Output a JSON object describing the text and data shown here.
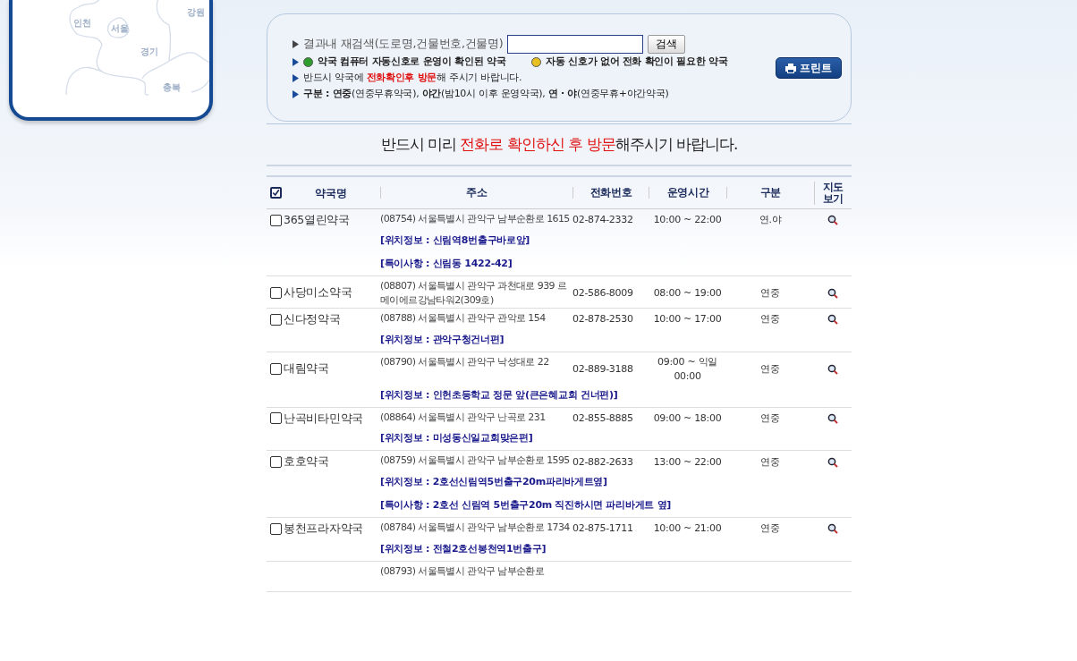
{
  "map": {
    "regions": [
      {
        "label": "강원"
      },
      {
        "label": "인천"
      },
      {
        "label": "서울"
      },
      {
        "label": "경기"
      },
      {
        "label": "충북"
      }
    ]
  },
  "search_panel": {
    "search_label": "결과내 재검색(도로명,건물번호,건물명)",
    "search_button": "검색",
    "legend": [
      {
        "color": "#2e9d2e",
        "text": "약국 컴퓨터 자동신호로 운영이 확인된 약국"
      },
      {
        "color": "#e8c020",
        "text": "자동 신호가 없어 전화 확인이 필요한 약국"
      }
    ],
    "notice": "반드시 약국에 **전화확인후 방문**해 주시기 바랍니다.",
    "legend_types": "**구분 : 연중**(연중무휴약국), **야간**(밤10시 이후 운영약국), **연 · 야**(연중무휴+야간약국)",
    "print_button": "프린트"
  },
  "banner": {
    "before": "반드시 미리 ",
    "highlight": "전화로 확인하신 후 방문",
    "after": "해주시기 바랍니다."
  },
  "table": {
    "select_all_checked": true,
    "columns": [
      "약국명",
      "주소",
      "전화번호",
      "운영시간",
      "구분",
      "지도\n보기"
    ],
    "rows": [
      {
        "checked": false,
        "name": "365열린약국",
        "address": "(08754) 서울특별시 관악구 남부순환로 1615",
        "phone": "02-874-2332",
        "hours": "10:00 ~ 22:00",
        "type": "연.야",
        "notes": [
          "[위치정보 : 신림역8번출구바로앞]",
          "[특이사항 : 신림동 1422-42]"
        ]
      },
      {
        "checked": false,
        "name": "사당미소약국",
        "address": "(08807) 서울특별시 관악구 과천대로 939 르메이에르강남타워2(309호)",
        "phone": "02-586-8009",
        "hours": "08:00 ~ 19:00",
        "type": "연중",
        "notes": []
      },
      {
        "checked": false,
        "name": "신다정약국",
        "address": "(08788) 서울특별시 관악구 관악로 154",
        "phone": "02-878-2530",
        "hours": "10:00 ~ 17:00",
        "type": "연중",
        "notes": [
          "[위치정보 : 관악구청건너편]"
        ]
      },
      {
        "checked": false,
        "name": "대림약국",
        "address": "(08790) 서울특별시 관악구 낙성대로 22",
        "phone": "02-889-3188",
        "hours": "09:00 ~ 익일 00:00",
        "type": "연중",
        "notes": [
          "[위치정보 : 인헌초등학교 정문 앞(큰은혜교회 건너편)]"
        ]
      },
      {
        "checked": false,
        "name": "난곡비타민약국",
        "address": "(08864) 서울특별시 관악구 난곡로 231",
        "phone": "02-855-8885",
        "hours": "09:00 ~ 18:00",
        "type": "연중",
        "notes": [
          "[위치정보 : 미성동신일교회맞은편]"
        ]
      },
      {
        "checked": false,
        "name": "호호약국",
        "address": "(08759) 서울특별시 관악구 남부순환로 1595",
        "phone": "02-882-2633",
        "hours": "13:00 ~ 22:00",
        "type": "연중",
        "notes": [
          "[위치정보 : 2호선신림역5번출구20m파리바게트옆]",
          "[특이사항 : 2호선 신림역 5번출구20m 직진하시면 파리바게트 옆]"
        ]
      },
      {
        "checked": false,
        "name": "봉천프라자약국",
        "address": "(08784) 서울특별시 관악구 남부순환로 1734",
        "phone": "02-875-1711",
        "hours": "10:00 ~ 21:00",
        "type": "연중",
        "notes": [
          "[위치정보 : 전철2호선봉천역1번출구]"
        ]
      },
      {
        "address": "(08793) 서울특별시 관악구 남부순환로"
      }
    ]
  }
}
